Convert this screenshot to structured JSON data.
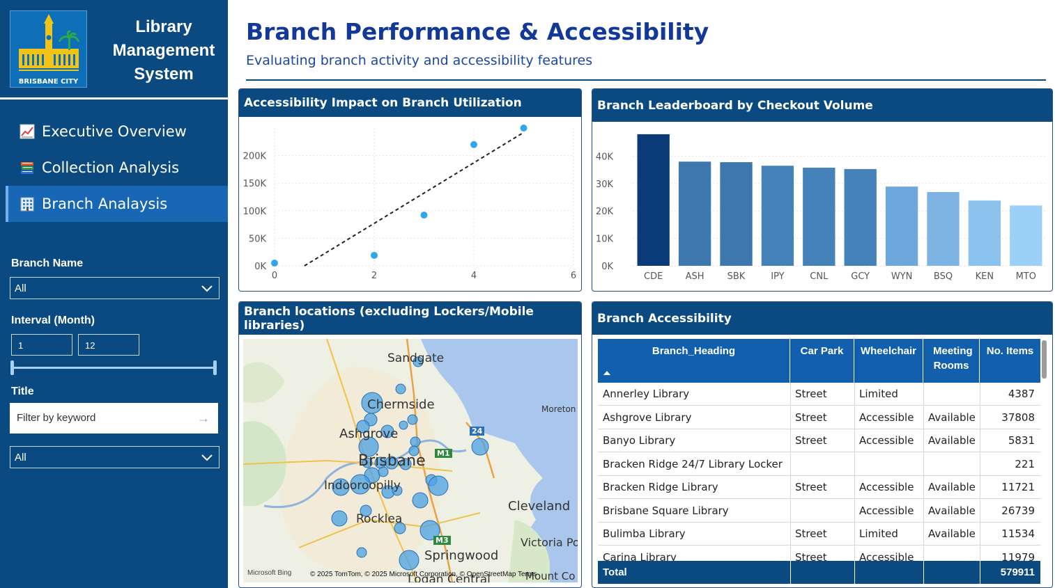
{
  "app": {
    "logo_caption": "BRISBANE CITY",
    "title_lines": [
      "Library",
      "Management",
      "System"
    ]
  },
  "nav": {
    "items": [
      {
        "label": "Executive Overview",
        "icon": "chart-increasing-icon"
      },
      {
        "label": "Collection Analysis",
        "icon": "books-icon"
      },
      {
        "label": "Branch Analaysis",
        "icon": "office-building-icon"
      }
    ],
    "active_index": 2
  },
  "filters": {
    "branch_name": {
      "label": "Branch Name",
      "value": "All"
    },
    "interval": {
      "label": "Interval (Month)",
      "from": "1",
      "to": "12"
    },
    "title": {
      "label": "Title",
      "search_placeholder": "Filter by keyword",
      "select_value": "All"
    }
  },
  "header": {
    "title": "Branch Performance & Accessibility",
    "subtitle": "Evaluating branch activity and accessibility features"
  },
  "scatter": {
    "title": "Accessibility Impact on Branch Utilization"
  },
  "barchart": {
    "title": "Branch Leaderboard by Checkout Volume"
  },
  "chart_data": [
    {
      "type": "scatter",
      "title": "Accessibility Impact on Branch Utilization",
      "x": [
        0,
        2,
        3,
        4,
        5
      ],
      "y": [
        5000,
        19000,
        92000,
        220000,
        250000
      ],
      "xlim": [
        0,
        6
      ],
      "ylim": [
        0,
        250000
      ],
      "xticks": [
        "0",
        "2",
        "4",
        "6"
      ],
      "yticks": [
        "0K",
        "50K",
        "100K",
        "150K",
        "200K"
      ],
      "trendline": {
        "x": [
          0.6,
          5
        ],
        "y": [
          0,
          242000
        ]
      },
      "colors": {
        "points": "#2ea8e8",
        "trend": "#222222"
      }
    },
    {
      "type": "bar",
      "title": "Branch Leaderboard by Checkout Volume",
      "categories": [
        "CDE",
        "ASH",
        "SBK",
        "IPY",
        "CNL",
        "GCY",
        "WYN",
        "BSQ",
        "KEN",
        "MTO"
      ],
      "values": [
        48000,
        38000,
        37800,
        36500,
        35800,
        35300,
        28900,
        26900,
        23800,
        22000
      ],
      "ylim": [
        0,
        50000
      ],
      "yticks": [
        "0K",
        "10K",
        "20K",
        "30K",
        "40K"
      ],
      "colors": [
        "#0b3a78",
        "#3c77ad",
        "#3c77ad",
        "#4682ba",
        "#4682ba",
        "#4682ba",
        "#6ea7db",
        "#7db3e3",
        "#8cc3ee",
        "#9dd0f7"
      ]
    }
  ],
  "map": {
    "title": "Branch locations (excluding Lockers/Mobile libraries)",
    "labels": [
      "Sandgate",
      "Chermside",
      "Ashgrove",
      "Brisbane",
      "Indooroopilly",
      "Rocklea",
      "Springwood",
      "Cleveland",
      "Victoria Po",
      "Moreton",
      "Logan Central",
      "Mount Co",
      "M1",
      "M3",
      "24"
    ],
    "credit": "© 2025 TomTom, © 2025 Microsoft Corporation, © OpenStreetMap  Terms",
    "bing": "Microsoft Bing"
  },
  "table": {
    "title": "Branch Accessibility",
    "columns": [
      "Branch_Heading",
      "Car Park",
      "Wheelchair",
      "Meeting Rooms",
      "No. Items"
    ],
    "rows": [
      [
        "Annerley Library",
        "Street",
        "Limited",
        "",
        "4387"
      ],
      [
        "Ashgrove Library",
        "Street",
        "Accessible",
        "Available",
        "37808"
      ],
      [
        "Banyo Library",
        "Street",
        "Accessible",
        "Available",
        "5831"
      ],
      [
        "Bracken Ridge 24/7 Library Locker",
        "",
        "",
        "",
        "221"
      ],
      [
        "Bracken Ridge Library",
        "Street",
        "Accessible",
        "Available",
        "11721"
      ],
      [
        "Brisbane Square Library",
        "",
        "Accessible",
        "Available",
        "26739"
      ],
      [
        "Bulimba Library",
        "Street",
        "Limited",
        "Available",
        "11534"
      ],
      [
        "Carina Library",
        "Street",
        "Accessible",
        "",
        "11979"
      ]
    ],
    "total_label": "Total",
    "total_value": "579911"
  }
}
